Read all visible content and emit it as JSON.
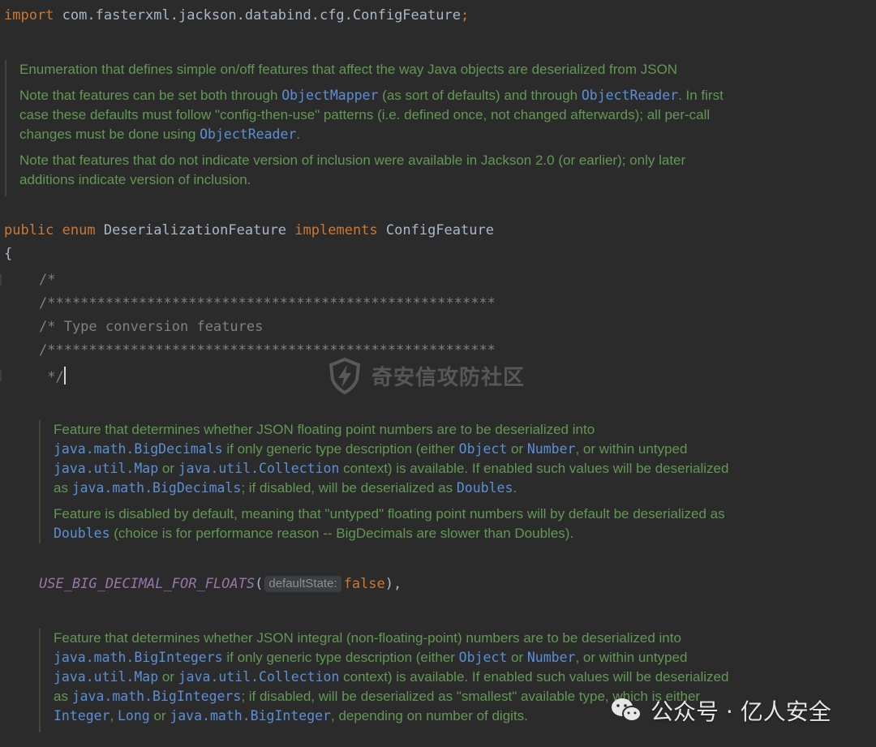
{
  "import_line": {
    "keyword": "import",
    "path": "com.fasterxml.jackson.databind.cfg.ConfigFeature",
    "semicolon": ";"
  },
  "class_doc": {
    "p1": "Enumeration that defines simple on/off features that affect the way Java objects are deserialized from JSON",
    "p2_a": "Note that features can be set both through ",
    "p2_link1": "ObjectMapper",
    "p2_b": " (as sort of defaults) and through ",
    "p2_link2": "ObjectReader",
    "p2_c": ". In first case these defaults must follow \"config-then-use\" patterns (i.e. defined once, not changed afterwards); all per-call changes must be done using ",
    "p2_link3": "ObjectReader",
    "p2_d": ".",
    "p3": "Note that features that do not indicate version of inclusion were available in Jackson 2.0 (or earlier); only later additions indicate version of inclusion."
  },
  "declaration": {
    "public_kw": "public",
    "enum_kw": "enum",
    "class_name": "DeserializationFeature",
    "implements_kw": "implements",
    "interface_name": "ConfigFeature",
    "open_brace": "{"
  },
  "block_comment": {
    "line1": "/*",
    "line2": "/******************************************************",
    "line3": "/* Type conversion features",
    "line4": "/******************************************************",
    "line5": " */"
  },
  "feature1_doc": {
    "a": "Feature that determines whether JSON floating point numbers are to be deserialized into ",
    "l1": "java.math.BigDecimals",
    "b": " if only generic type description (either ",
    "l2": "Object",
    "c": " or ",
    "l3": "Number",
    "d": ", or within untyped ",
    "l4": "java.util.Map",
    "e": " or ",
    "l5": "java.util.Collection",
    "f": " context) is available. If enabled such values will be deserialized as ",
    "l6": "java.math.BigDecimals",
    "g": "; if disabled, will be deserialized as ",
    "l7": "Doubles",
    "h": ".",
    "p2_a": "Feature is disabled by default, meaning that \"untyped\" floating point numbers will by default be deserialized as ",
    "p2_l1": "Doubles",
    "p2_b": " (choice is for performance reason -- BigDecimals are slower than Doubles)."
  },
  "feature1_decl": {
    "name": "USE_BIG_DECIMAL_FOR_FLOATS",
    "open_paren": "(",
    "hint": "defaultState:",
    "value": "false",
    "close": "),"
  },
  "feature2_doc": {
    "a": "Feature that determines whether JSON integral (non-floating-point) numbers are to be deserialized into ",
    "l1": "java.math.BigIntegers",
    "b": " if only generic type description (either ",
    "l2": "Object",
    "c": " or ",
    "l3": "Number",
    "d": ", or within untyped ",
    "l4": "java.util.Map",
    "e": " or ",
    "l5": "java.util.Collection",
    "f": " context) is available. If enabled such values will be deserialized as ",
    "l6": "java.math.BigIntegers",
    "g": "; if disabled, will be deserialized as \"smallest\" available type, which is either ",
    "l7": "Integer",
    "h": ", ",
    "l8": "Long",
    "i": " or ",
    "l9": "java.math.BigInteger",
    "j": ", depending on number of digits."
  },
  "watermarks": {
    "center_text": "奇安信攻防社区",
    "bottom_text": "公众号 · 亿人安全"
  },
  "colors": {
    "background": "#2b2b2b",
    "keyword": "#cc7832",
    "doc_text": "#629755",
    "doc_link": "#5a8fd6",
    "enum_constant": "#9876aa",
    "comment": "#808080"
  }
}
